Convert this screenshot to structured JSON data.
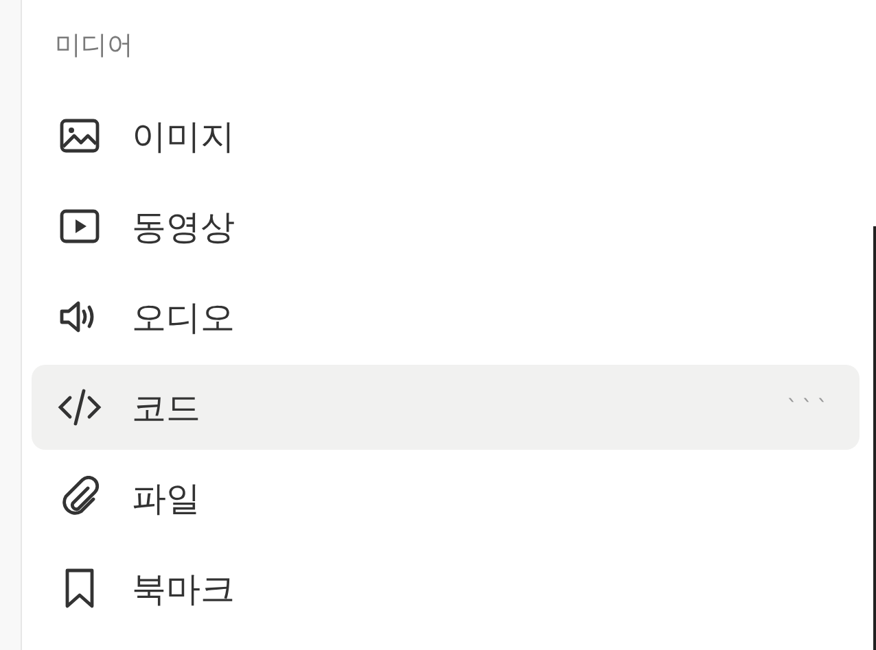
{
  "section": {
    "label": "미디어"
  },
  "items": [
    {
      "label": "이미지",
      "selected": false
    },
    {
      "label": "동영상",
      "selected": false
    },
    {
      "label": "오디오",
      "selected": false
    },
    {
      "label": "코드",
      "selected": true,
      "shortcut": "```"
    },
    {
      "label": "파일",
      "selected": false
    },
    {
      "label": "북마크",
      "selected": false
    }
  ]
}
